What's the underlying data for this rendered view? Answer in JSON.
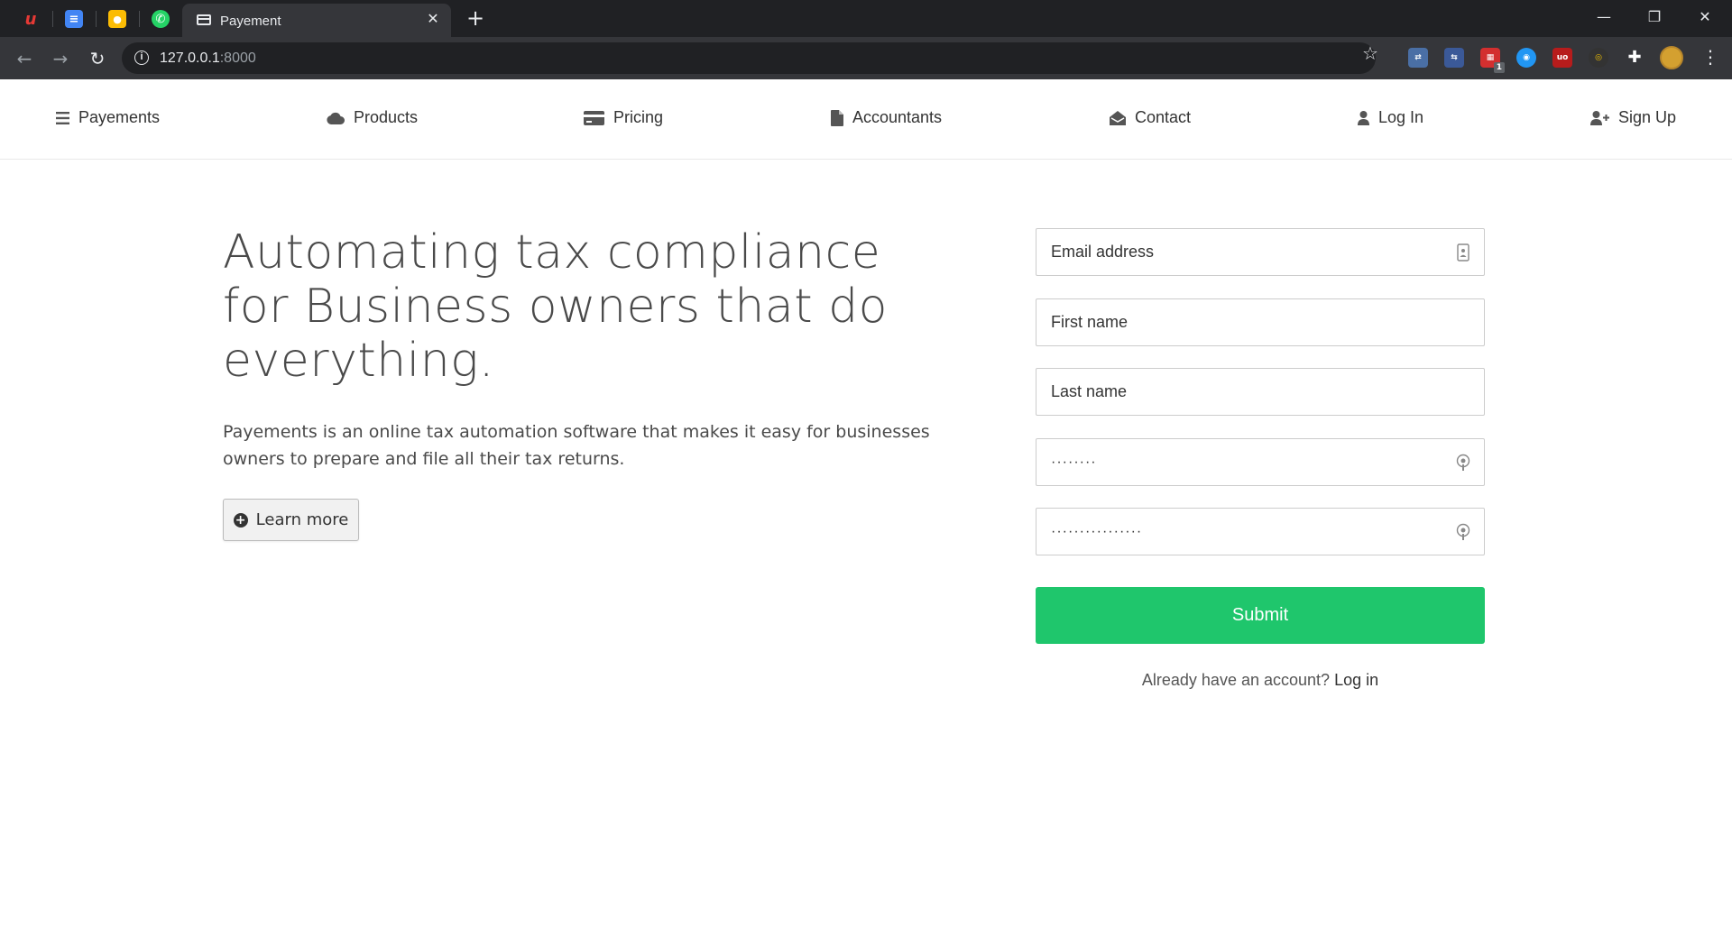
{
  "browser": {
    "pinned_tabs": [
      {
        "icon": "u-logo-icon",
        "glyph": "u",
        "color": "#e53935"
      },
      {
        "icon": "docs-icon",
        "glyph": "≡",
        "color": "#4285f4"
      },
      {
        "icon": "keep-icon",
        "glyph": "💡",
        "color": "#fbbc04"
      },
      {
        "icon": "whatsapp-icon",
        "glyph": "✆",
        "color": "#25d366"
      }
    ],
    "active_tab": {
      "title": "Payement",
      "close": "✕"
    },
    "new_tab": "+",
    "window_controls": {
      "minimize": "—",
      "restore": "❐",
      "close": "✕"
    },
    "url_host": "127.0.0.1",
    "url_port": ":8000",
    "extensions_badge": "1"
  },
  "nav": {
    "brand": "Payements",
    "items": [
      {
        "label": "Products",
        "icon": "cloud-icon"
      },
      {
        "label": "Pricing",
        "icon": "credit-card-icon"
      },
      {
        "label": "Accountants",
        "icon": "file-icon"
      },
      {
        "label": "Contact",
        "icon": "envelope-open-icon"
      },
      {
        "label": "Log In",
        "icon": "user-icon"
      },
      {
        "label": "Sign Up",
        "icon": "user-plus-icon"
      }
    ]
  },
  "hero": {
    "title": "Automating tax compliance for Business owners that do everything.",
    "text": "Payements is an online tax automation software that makes it easy for businesses owners to prepare and file all their tax returns.",
    "button": "Learn more"
  },
  "form": {
    "email_placeholder": "Email address",
    "first_name_placeholder": "First name",
    "last_name_placeholder": "Last name",
    "password_value": "········",
    "confirm_password_value": "················",
    "submit": "Submit",
    "account_prompt": "Already have an account?",
    "login_link": "Log in"
  },
  "colors": {
    "submit": "#1fc66c",
    "chrome_dark": "#202124",
    "chrome_toolbar": "#35363a"
  }
}
